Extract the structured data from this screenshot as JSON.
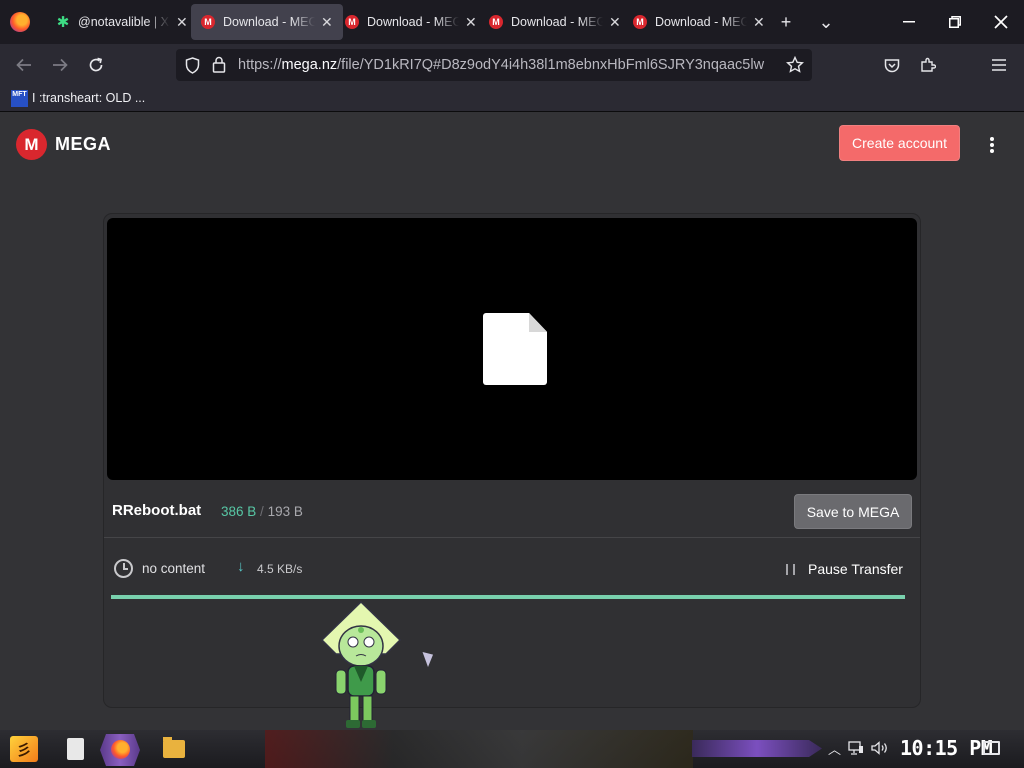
{
  "browser": {
    "tabs": [
      {
        "label": "@notavalible | X",
        "favicon": "green-star-icon",
        "active": false
      },
      {
        "label": "Download - MEGA",
        "favicon": "mega-icon",
        "active": true
      },
      {
        "label": "Download - MEGA",
        "favicon": "mega-icon",
        "active": false
      },
      {
        "label": "Download - MEGA",
        "favicon": "mega-icon",
        "active": false
      },
      {
        "label": "Download - MEGA",
        "favicon": "mega-icon",
        "active": false
      }
    ],
    "new_tab_glyph": "+",
    "list_tabs_glyph": "⌄",
    "url_domain": "mega.nz",
    "url_prefix": "https://",
    "url_path": "/file/YD1kRI7Q#D8z9odY4i4h38l1m8ebnxHbFml6SJRY3nqaac5lw",
    "bookmark": {
      "favicon_text": "MFT",
      "label": "I :transheart: OLD ..."
    }
  },
  "page": {
    "logo_letter": "M",
    "logo_word": "MEGA",
    "create_account_label": "Create account",
    "file_name": "RReboot.bat",
    "size_downloaded": "386 B",
    "size_separator": "/",
    "size_total": "193 B",
    "save_label": "Save to MEGA",
    "status_text": "no content",
    "speed": "4.5 KB/s",
    "pause_label": "Pause Transfer",
    "progress_percent": 100,
    "accent_color": "#d9272e",
    "create_button_color": "#f46a6a",
    "progress_color": "#79d1ae"
  },
  "taskbar": {
    "start_glyph": "彡",
    "clock": "10:15 PM"
  }
}
